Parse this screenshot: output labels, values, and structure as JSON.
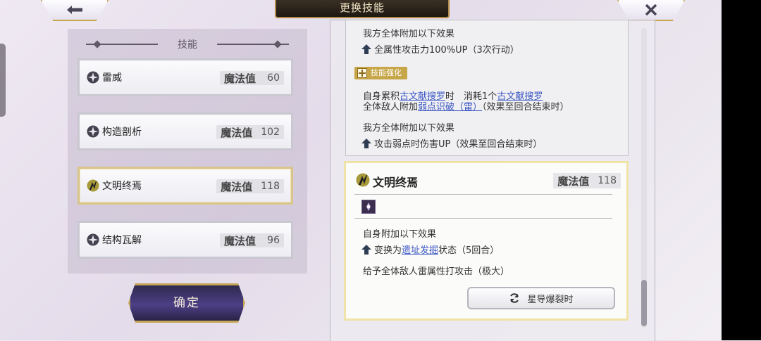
{
  "header": {
    "title": "更换技能"
  },
  "left_panel": {
    "heading": "技能",
    "skills": [
      {
        "name": "雷威",
        "mp_label": "魔法值",
        "mp": "60",
        "selected": false
      },
      {
        "name": "构造剖析",
        "mp_label": "魔法值",
        "mp": "102",
        "selected": false
      },
      {
        "name": "文明终焉",
        "mp_label": "魔法值",
        "mp": "118",
        "selected": true
      },
      {
        "name": "结构瓦解",
        "mp_label": "魔法值",
        "mp": "96",
        "selected": false
      }
    ],
    "confirm_label": "确定"
  },
  "detail_a": {
    "line1": "我方全体附加以下效果",
    "line2": "全属性攻击力100%UP（3次行动）",
    "badge": "技能强化",
    "line3_pre": "自身累积",
    "line3_link1": "古文献搜罗",
    "line3_mid": "时　消耗1个",
    "line3_link2": "古文献搜罗",
    "line4_pre": "全体敌人附加",
    "line4_link": "弱点识破（雷）",
    "line4_post": "（效果至回合结束时）",
    "line5": "我方全体附加以下效果",
    "line6": "攻击弱点时伤害UP（效果至回合结束时）"
  },
  "detail_b": {
    "name": "文明终焉",
    "mp_label": "魔法值",
    "mp": "118",
    "line1": "自身附加以下效果",
    "line2_pre": "变换为",
    "line2_link": "遗址发掘",
    "line2_post": "状态（5回合）",
    "line3": "给予全体敌人雷属性打攻击（极大）",
    "timing": "星导爆裂时"
  },
  "colors": {
    "accent_gold": "#c8a64e",
    "link_blue": "#3b57c4",
    "confirm_purple": "#4d3f86"
  },
  "icons": [
    "back-arrow-icon",
    "close-x-icon",
    "thunder-skill-icon",
    "lightning-skill-icon",
    "up-arrow-icon",
    "plus-icon",
    "refresh-icon"
  ]
}
